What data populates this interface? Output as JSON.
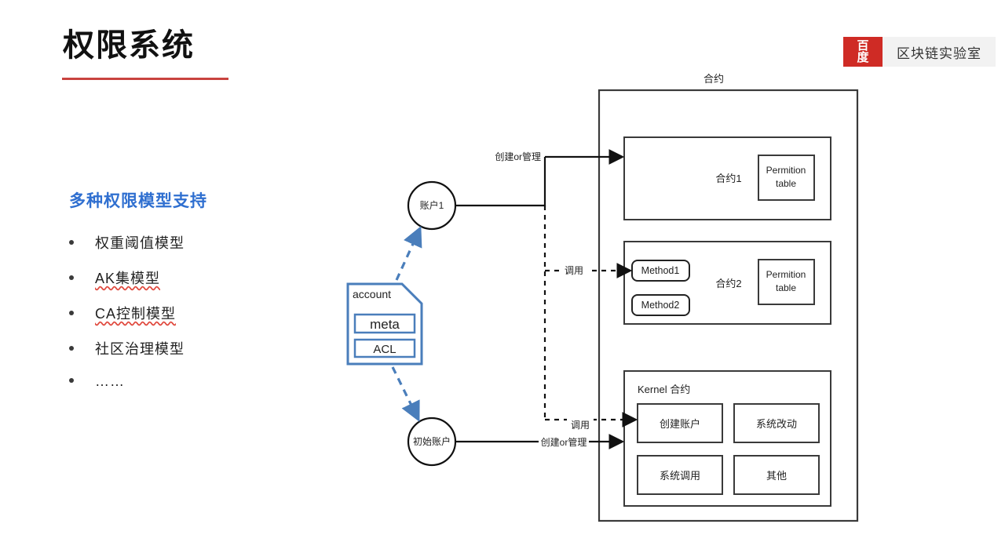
{
  "header": {
    "title": "权限系统",
    "rule_color": "#c9433f",
    "brand": {
      "mark_line1": "百",
      "mark_line2": "度",
      "mark_color": "#cf2b25",
      "name": "区块链实验室"
    }
  },
  "left_panel": {
    "heading": "多种权限模型支持",
    "heading_color": "#2f6fd0",
    "bullets": [
      {
        "text": "权重阈值模型",
        "spell_error": false
      },
      {
        "text": "AK集模型",
        "spell_error": true
      },
      {
        "text": "CA控制模型",
        "spell_error": true
      },
      {
        "text": "社区治理模型",
        "spell_error": false
      },
      {
        "text": "……",
        "spell_error": false
      }
    ]
  },
  "diagram": {
    "account_card": {
      "title": "account",
      "border_color": "#4a7ebb",
      "fields": [
        {
          "label": "meta"
        },
        {
          "label": "ACL"
        }
      ]
    },
    "actors": [
      {
        "id": "account1",
        "label": "账户1"
      },
      {
        "id": "init-account",
        "label": "初始账户"
      }
    ],
    "container": {
      "label": "合约"
    },
    "edges": [
      {
        "id": "create-manage-top",
        "label": "创建or管理",
        "style": "solid"
      },
      {
        "id": "invoke-contract2",
        "label": "调用",
        "style": "dashed"
      },
      {
        "id": "invoke-kernel",
        "label": "调用",
        "style": "dashed"
      },
      {
        "id": "create-manage-bottom",
        "label": "创建or管理",
        "style": "solid"
      }
    ],
    "contracts": [
      {
        "id": "contract1",
        "label": "合约1",
        "methods": [],
        "permission_table": "Permition\ntable",
        "permission_table_line1": "Permition",
        "permission_table_line2": "table"
      },
      {
        "id": "contract2",
        "label": "合约2",
        "methods": [
          "Method1",
          "Method2"
        ],
        "permission_table_line1": "Permition",
        "permission_table_line2": "table"
      }
    ],
    "kernel": {
      "label": "Kernel 合约",
      "items": [
        "创建账户",
        "系统改动",
        "系统调用",
        "其他"
      ]
    }
  }
}
